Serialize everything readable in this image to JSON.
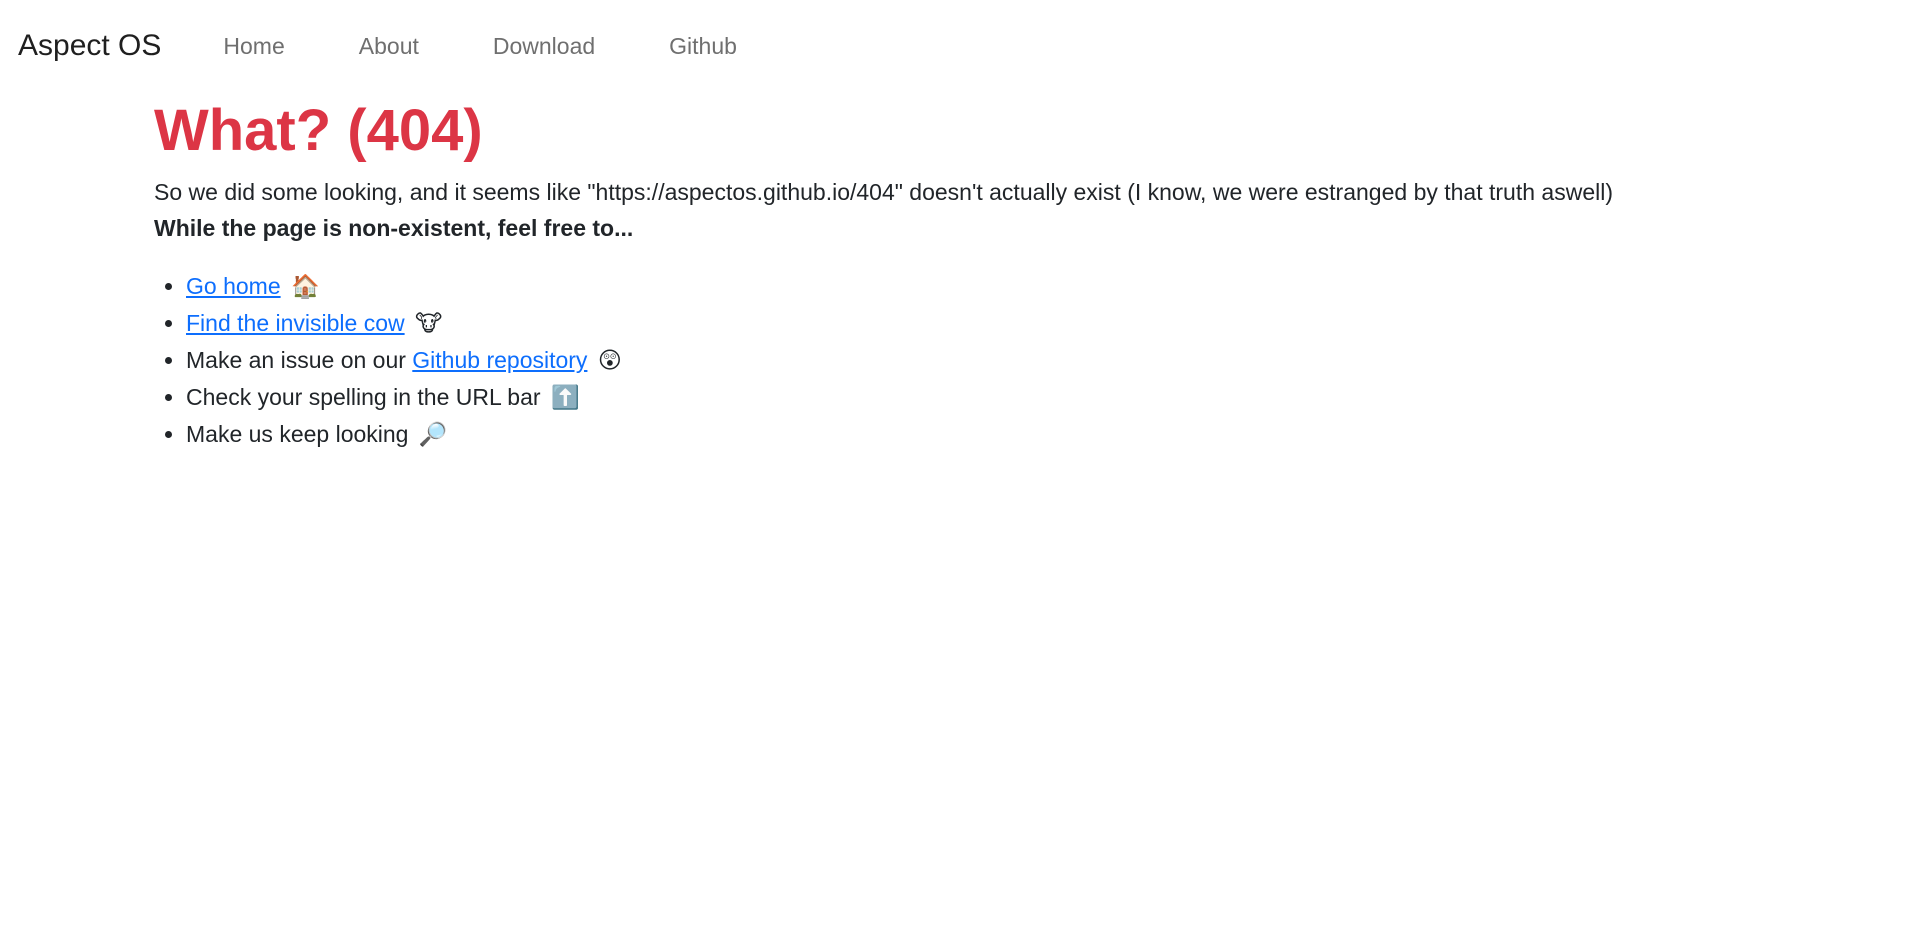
{
  "navbar": {
    "brand": "Aspect OS",
    "links": [
      {
        "label": "Home"
      },
      {
        "label": "About"
      },
      {
        "label": "Download"
      },
      {
        "label": "Github"
      }
    ]
  },
  "main": {
    "title": "What? (404)",
    "description": "So we did some looking, and it seems like \"https://aspectos.github.io/404\" doesn't actually exist (I know, we were estranged by that truth aswell)",
    "subheading": "While the page is non-existent, feel free to...",
    "items": [
      {
        "link": "Go home",
        "emoji": "🏠",
        "icon": "house-icon"
      },
      {
        "link": "Find the invisible cow",
        "emoji": "🐮",
        "icon": "cow-icon"
      },
      {
        "prefix": "Make an issue on our ",
        "link": "Github repository",
        "emoji": "😲",
        "icon": "astonished-face-icon"
      },
      {
        "text": "Check your spelling in the URL bar",
        "emoji": "⬆️",
        "icon": "up-arrow-icon"
      },
      {
        "text": "Make us keep looking",
        "emoji": "🔎",
        "icon": "magnifying-glass-icon"
      }
    ]
  },
  "colors": {
    "title": "#dc3545",
    "link": "#0d6efd",
    "nav_link": "#6f6f6f",
    "text": "#212529"
  }
}
